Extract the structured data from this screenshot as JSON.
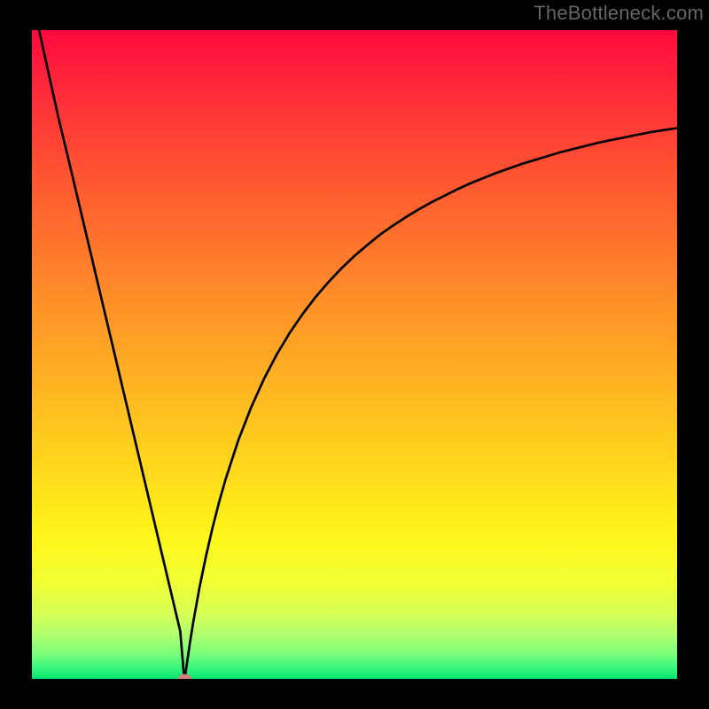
{
  "watermark": "TheBottleneck.com",
  "chart_data": {
    "type": "line",
    "title": "",
    "xlabel": "",
    "ylabel": "",
    "xlim": [
      0,
      100
    ],
    "ylim": [
      0,
      100
    ],
    "grid": false,
    "legend": false,
    "minimum_x": 23.7,
    "marker": {
      "x": 23.7,
      "y": 0,
      "color": "#d97c7c"
    },
    "series": [
      {
        "name": "bottleneck-curve",
        "x": [
          0,
          2,
          4,
          6,
          8,
          10,
          12,
          14,
          16,
          18,
          20,
          21,
          22,
          23,
          23.5,
          23.7,
          24,
          24.5,
          25,
          26,
          27,
          28,
          29,
          30,
          32,
          34,
          36,
          38,
          40,
          42,
          44,
          46,
          48,
          50,
          52,
          54,
          56,
          58,
          60,
          62,
          64,
          66,
          68,
          70,
          72,
          74,
          76,
          78,
          80,
          82,
          84,
          86,
          88,
          90,
          92,
          94,
          96,
          98,
          100
        ],
        "values": [
          105,
          96,
          87,
          78.7,
          70.3,
          61.9,
          53.5,
          45.1,
          36.7,
          28.3,
          19.9,
          15.7,
          11.5,
          7.3,
          1.3,
          0,
          2.2,
          5.6,
          8.7,
          14.2,
          19,
          23.3,
          27.2,
          30.7,
          36.8,
          41.9,
          46.3,
          50.1,
          53.4,
          56.3,
          58.9,
          61.2,
          63.3,
          65.2,
          66.9,
          68.5,
          69.9,
          71.2,
          72.4,
          73.5,
          74.5,
          75.5,
          76.4,
          77.2,
          78,
          78.7,
          79.4,
          80,
          80.6,
          81.2,
          81.7,
          82.2,
          82.7,
          83.1,
          83.5,
          83.9,
          84.3,
          84.6,
          84.9
        ]
      }
    ],
    "background_gradient": {
      "stops": [
        {
          "offset": 0.0,
          "color": "#ff0a3e"
        },
        {
          "offset": 0.1,
          "color": "#ff2c39"
        },
        {
          "offset": 0.2,
          "color": "#ff4d33"
        },
        {
          "offset": 0.3,
          "color": "#ff6c2e"
        },
        {
          "offset": 0.4,
          "color": "#ff8a29"
        },
        {
          "offset": 0.5,
          "color": "#ffa724"
        },
        {
          "offset": 0.6,
          "color": "#ffc31f"
        },
        {
          "offset": 0.7,
          "color": "#ffdf1b"
        },
        {
          "offset": 0.78,
          "color": "#fff61a"
        },
        {
          "offset": 0.85,
          "color": "#f1ff33"
        },
        {
          "offset": 0.9,
          "color": "#d6ff55"
        },
        {
          "offset": 0.93,
          "color": "#b3ff6d"
        },
        {
          "offset": 0.96,
          "color": "#7dff7a"
        },
        {
          "offset": 0.985,
          "color": "#33f57e"
        },
        {
          "offset": 1.0,
          "color": "#05e36e"
        }
      ]
    }
  }
}
